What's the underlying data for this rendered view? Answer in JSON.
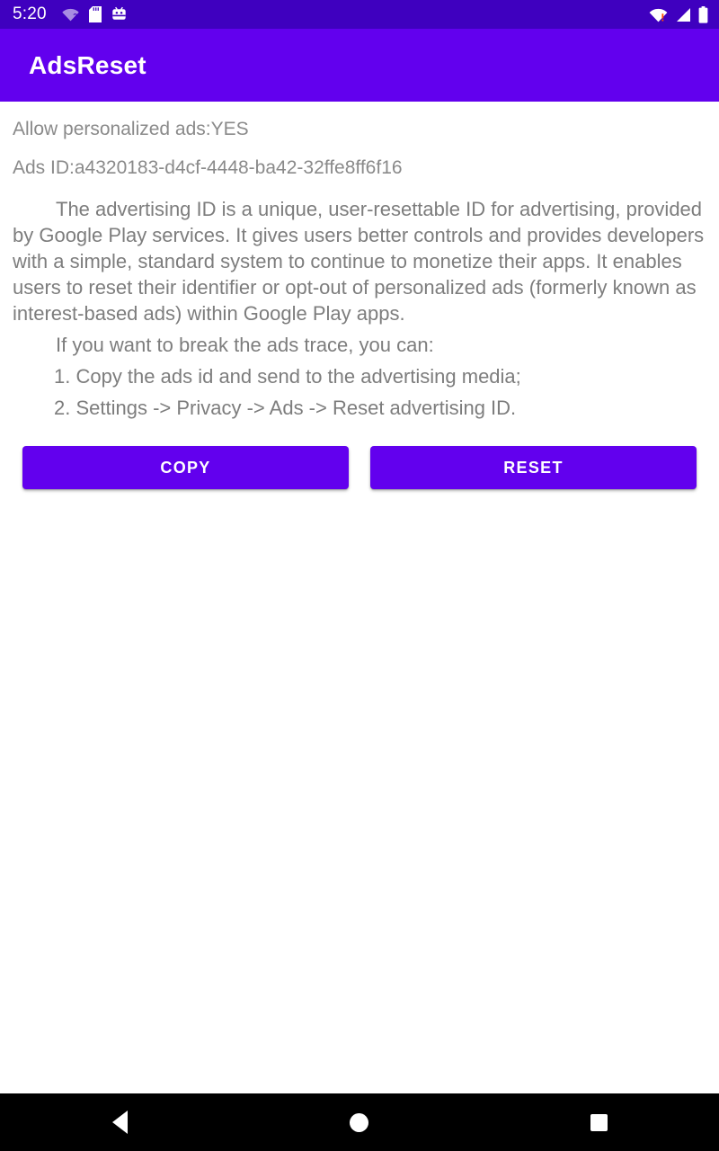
{
  "status_bar": {
    "clock": "5:20",
    "background": "#3f00bf",
    "left_icons": [
      "wifi-unknown-icon",
      "sd-card-icon",
      "adb-icon"
    ],
    "right_icons": [
      "wifi-warning-icon",
      "cellular-signal-icon",
      "battery-icon"
    ]
  },
  "app_bar": {
    "title": "AdsReset",
    "background": "#6200ee",
    "text_color": "#ffffff"
  },
  "main": {
    "personalized_ads_line": "Allow personalized ads:YES",
    "ads_id_line": "Ads ID:a4320183-d4cf-4448-ba42-32ffe8ff6f16",
    "description": "The advertising ID is a unique, user-resettable ID for advertising, provided by Google Play services. It gives users better controls and provides developers with a simple, standard system to continue to monetize their apps. It enables users to reset their identifier or opt-out of personalized ads (formerly known as interest-based ads) within Google Play apps.",
    "break_trace_intro": "If you want to break the ads trace, you can:",
    "steps": [
      "1. Copy the ads id and send to the advertising media;",
      "2. Settings -> Privacy -> Ads -> Reset advertising ID."
    ],
    "text_color": "#7d7d7d"
  },
  "buttons": {
    "copy_label": "COPY",
    "reset_label": "RESET",
    "background": "#6200ee",
    "text_color": "#ffffff"
  },
  "nav_bar": {
    "background": "#000000",
    "items": [
      "back-button",
      "home-button",
      "recents-button"
    ]
  }
}
